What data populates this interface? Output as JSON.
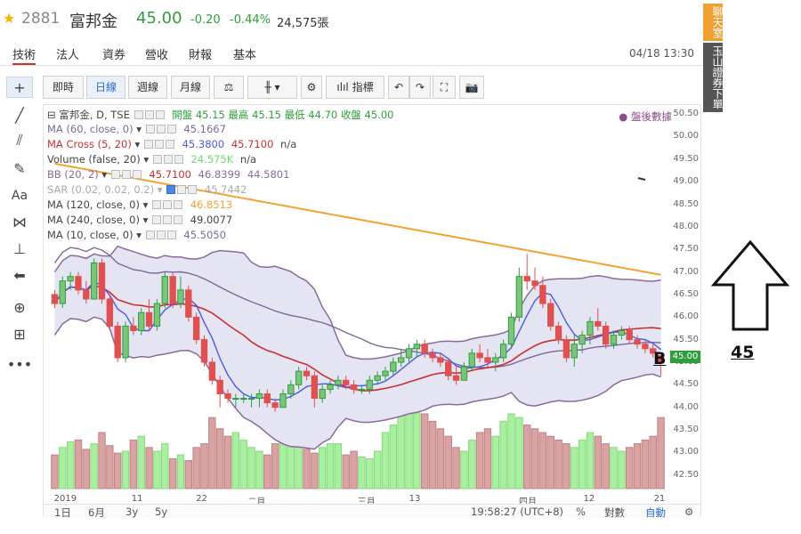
{
  "header": {
    "code": "2881",
    "name": "富邦金",
    "price": "45.00",
    "change": "-0.20",
    "change_pct": "-0.44%",
    "volume": "24,575張",
    "star_icon": "star-icon"
  },
  "tabs": [
    {
      "label": "技術"
    },
    {
      "label": "法人"
    },
    {
      "label": "資券"
    },
    {
      "label": "營收"
    },
    {
      "label": "財報"
    },
    {
      "label": "基本"
    }
  ],
  "datetime": "04/18 13:30",
  "toolbar": {
    "buttons": [
      "即時",
      "日線",
      "週線",
      "月線"
    ],
    "indicator_label": "指標"
  },
  "legend": {
    "main": "富邦金, D, TSE",
    "ohlc_text": "開盤 45.15 最高 45.15 最低 44.70 收盤 45.00",
    "rows": [
      {
        "label": "MA (60, close, 0)",
        "values": [
          "45.1667"
        ]
      },
      {
        "label": "MA Cross (5, 20)",
        "values": [
          "45.3800",
          "45.7100",
          "n/a"
        ]
      },
      {
        "label": "Volume (false, 20)",
        "values": [
          "24.575K",
          "n/a"
        ]
      },
      {
        "label": "BB (20, 2)",
        "values": [
          "45.7100",
          "46.8399",
          "44.5801"
        ]
      },
      {
        "label": "SAR (0.02, 0.02, 0.2)",
        "values": [
          "45.7442"
        ]
      },
      {
        "label": "MA (120, close, 0)",
        "values": [
          "46.8513"
        ]
      },
      {
        "label": "MA (240, close, 0)",
        "values": [
          "49.0077"
        ]
      },
      {
        "label": "MA (10, close, 0)",
        "values": [
          "45.5050"
        ]
      }
    ],
    "after_hours": "盤後數據"
  },
  "yaxis": {
    "ticks": [
      "50.50",
      "50.00",
      "49.50",
      "49.00",
      "48.50",
      "48.00",
      "47.50",
      "47.00",
      "46.50",
      "46.00",
      "45.50",
      "45.00",
      "44.50",
      "44.00",
      "43.50",
      "43.00",
      "42.50"
    ],
    "last_price": "45.00"
  },
  "xaxis": {
    "ticks": [
      "2019",
      "11",
      "22",
      "二月",
      "三月",
      "13",
      "四月",
      "12",
      "21"
    ]
  },
  "bottombar": {
    "ranges": [
      "1日",
      "6月",
      "3y",
      "5y"
    ],
    "time": "19:58:27 (UTC+8)",
    "pct": "%",
    "log": "對數",
    "auto": "自動"
  },
  "sidebar_right": {
    "tab1": "聊天室",
    "tab2": "玉山證券下單"
  },
  "annotations": {
    "b_label": "B",
    "price_label": "45"
  },
  "colors": {
    "up": "#2e9e3a",
    "down": "#e05050",
    "ma120": "#f5a030",
    "bb": "#8b6a9b",
    "ma_blue": "#4a5ae8",
    "ma_red": "#c83030"
  },
  "chart_data": {
    "type": "candlestick",
    "ylim": [
      42.2,
      50.6
    ],
    "days": 78,
    "candles": [
      [
        46.5,
        46.6,
        46.2,
        46.3
      ],
      [
        46.3,
        46.9,
        46.2,
        46.8
      ],
      [
        46.8,
        47.0,
        46.6,
        46.9
      ],
      [
        46.9,
        47.0,
        46.5,
        46.6
      ],
      [
        46.6,
        46.8,
        46.3,
        46.4
      ],
      [
        46.4,
        47.3,
        46.4,
        47.2
      ],
      [
        47.2,
        47.3,
        46.3,
        46.4
      ],
      [
        46.4,
        46.5,
        45.7,
        45.8
      ],
      [
        45.8,
        45.9,
        45.0,
        45.1
      ],
      [
        45.1,
        45.9,
        45.0,
        45.8
      ],
      [
        45.8,
        46.0,
        45.6,
        45.7
      ],
      [
        45.7,
        46.2,
        45.6,
        46.1
      ],
      [
        46.1,
        46.4,
        45.7,
        45.8
      ],
      [
        45.8,
        46.4,
        45.7,
        46.3
      ],
      [
        46.3,
        47.0,
        46.2,
        46.9
      ],
      [
        46.9,
        47.0,
        46.2,
        46.3
      ],
      [
        46.3,
        46.9,
        46.2,
        46.6
      ],
      [
        46.6,
        46.7,
        45.9,
        46.0
      ],
      [
        46.0,
        46.1,
        45.4,
        45.5
      ],
      [
        45.5,
        45.6,
        44.9,
        45.0
      ],
      [
        45.0,
        45.1,
        44.5,
        44.6
      ],
      [
        44.6,
        44.7,
        44.0,
        44.3
      ],
      [
        44.3,
        44.4,
        44.1,
        44.2
      ],
      [
        44.2,
        44.3,
        44.0,
        44.2
      ],
      [
        44.2,
        44.3,
        44.1,
        44.2
      ],
      [
        44.2,
        44.3,
        44.0,
        44.2
      ],
      [
        44.2,
        44.4,
        44.0,
        44.3
      ],
      [
        44.3,
        44.4,
        44.0,
        44.1
      ],
      [
        44.1,
        44.2,
        43.9,
        44.0
      ],
      [
        44.0,
        44.4,
        44.0,
        44.3
      ],
      [
        44.3,
        44.6,
        44.2,
        44.5
      ],
      [
        44.5,
        44.9,
        44.4,
        44.8
      ],
      [
        44.8,
        44.9,
        44.6,
        44.7
      ],
      [
        44.7,
        44.8,
        44.0,
        44.2
      ],
      [
        44.2,
        44.5,
        44.1,
        44.4
      ],
      [
        44.4,
        44.6,
        44.3,
        44.5
      ],
      [
        44.5,
        44.7,
        44.4,
        44.6
      ],
      [
        44.6,
        44.7,
        44.4,
        44.5
      ],
      [
        44.5,
        44.6,
        44.3,
        44.4
      ],
      [
        44.4,
        44.5,
        44.3,
        44.4
      ],
      [
        44.4,
        44.7,
        44.3,
        44.6
      ],
      [
        44.6,
        44.8,
        44.5,
        44.7
      ],
      [
        44.7,
        44.9,
        44.6,
        44.8
      ],
      [
        44.8,
        45.1,
        44.7,
        45.0
      ],
      [
        45.0,
        45.3,
        44.9,
        45.1
      ],
      [
        45.1,
        45.4,
        45.0,
        45.3
      ],
      [
        45.3,
        45.5,
        45.1,
        45.4
      ],
      [
        45.4,
        45.5,
        45.1,
        45.2
      ],
      [
        45.2,
        45.3,
        45.0,
        45.1
      ],
      [
        45.1,
        45.2,
        44.9,
        45.0
      ],
      [
        45.0,
        45.1,
        44.6,
        44.7
      ],
      [
        44.7,
        44.9,
        44.5,
        44.6
      ],
      [
        44.6,
        45.0,
        44.6,
        44.9
      ],
      [
        44.9,
        45.3,
        44.8,
        45.2
      ],
      [
        45.2,
        45.4,
        45.0,
        45.1
      ],
      [
        45.1,
        45.3,
        44.9,
        45.0
      ],
      [
        45.0,
        45.2,
        44.8,
        45.1
      ],
      [
        45.1,
        45.5,
        45.0,
        45.4
      ],
      [
        45.4,
        46.1,
        45.3,
        46.0
      ],
      [
        46.0,
        47.1,
        45.9,
        46.9
      ],
      [
        46.9,
        47.4,
        46.6,
        46.8
      ],
      [
        46.8,
        47.1,
        46.6,
        46.7
      ],
      [
        46.7,
        46.9,
        46.2,
        46.3
      ],
      [
        46.3,
        46.4,
        45.7,
        45.8
      ],
      [
        45.8,
        45.9,
        45.4,
        45.5
      ],
      [
        45.5,
        45.6,
        45.0,
        45.1
      ],
      [
        45.1,
        45.6,
        44.9,
        45.4
      ],
      [
        45.4,
        45.7,
        45.2,
        45.6
      ],
      [
        45.6,
        46.0,
        45.4,
        45.9
      ],
      [
        45.9,
        46.2,
        45.7,
        45.8
      ],
      [
        45.8,
        45.9,
        45.3,
        45.4
      ],
      [
        45.4,
        45.7,
        45.3,
        45.6
      ],
      [
        45.6,
        45.8,
        45.5,
        45.7
      ],
      [
        45.7,
        45.8,
        45.4,
        45.5
      ],
      [
        45.5,
        45.6,
        45.3,
        45.4
      ],
      [
        45.4,
        45.5,
        45.2,
        45.3
      ],
      [
        45.3,
        45.4,
        45.1,
        45.2
      ],
      [
        45.15,
        45.15,
        44.7,
        45.0
      ]
    ],
    "volumes": [
      18,
      22,
      25,
      26,
      21,
      24,
      30,
      23,
      19,
      20,
      26,
      28,
      22,
      20,
      24,
      16,
      18,
      15,
      22,
      24,
      38,
      32,
      28,
      30,
      26,
      22,
      20,
      18,
      24,
      26,
      28,
      26,
      21,
      19,
      22,
      24,
      24,
      18,
      20,
      17,
      16,
      20,
      30,
      34,
      42,
      48,
      44,
      40,
      36,
      32,
      28,
      22,
      20,
      26,
      30,
      32,
      28,
      36,
      40,
      38,
      34,
      32,
      30,
      28,
      26,
      24,
      22,
      26,
      30,
      28,
      24,
      22,
      20,
      22,
      24,
      26,
      28,
      38
    ]
  }
}
